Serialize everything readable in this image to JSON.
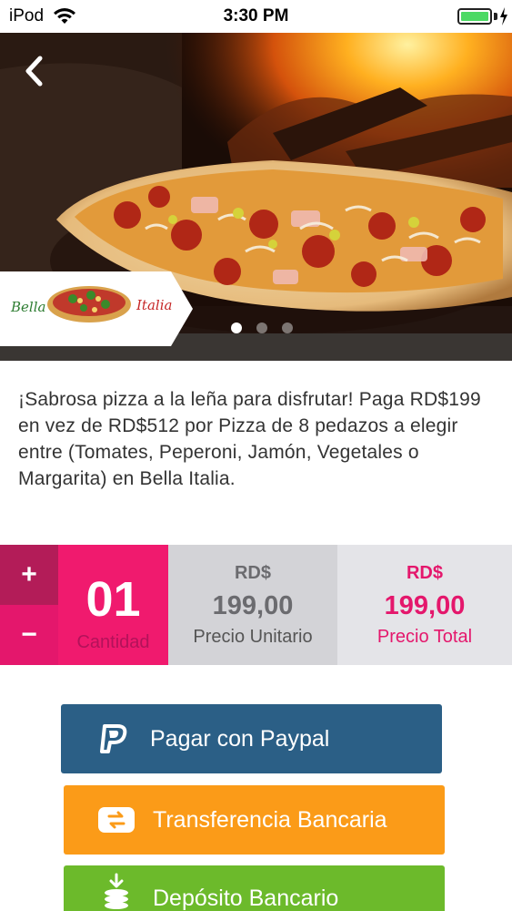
{
  "status_bar": {
    "device": "iPod",
    "time": "3:30 PM",
    "battery_percent": 100
  },
  "hero": {
    "logo_text_left": "Bella",
    "logo_text_right": "Italia",
    "carousel_total": 3,
    "carousel_active": 1
  },
  "description": "¡Sabrosa pizza a la leña para disfrutar! Paga RD$199 en vez de RD$512 por Pizza de 8 pedazos a elegir entre (Tomates, Peperoni, Jamón, Vegetales o Margarita) en Bella Italia.",
  "quantity": {
    "plus_label": "+",
    "minus_label": "−",
    "value": "01",
    "label": "Cantidad"
  },
  "unit_price": {
    "currency": "RD$",
    "amount": "199,00",
    "label": "Precio Unitario"
  },
  "total_price": {
    "currency": "RD$",
    "amount": "199,00",
    "label": "Precio Total"
  },
  "payment": {
    "paypal_label": "Pagar con Paypal",
    "transfer_label": "Transferencia Bancaria",
    "deposit_label": "Depósito Bancario"
  },
  "colors": {
    "accent_pink": "#e4176c",
    "paypal_blue": "#2b5f86",
    "transfer_orange": "#fb9b18",
    "deposit_green": "#6cba2b"
  },
  "icons": {
    "back": "chevron-left-icon",
    "paypal": "paypal-icon",
    "transfer": "bank-transfer-icon",
    "deposit": "coins-deposit-icon",
    "wifi": "wifi-icon",
    "battery": "battery-icon"
  }
}
